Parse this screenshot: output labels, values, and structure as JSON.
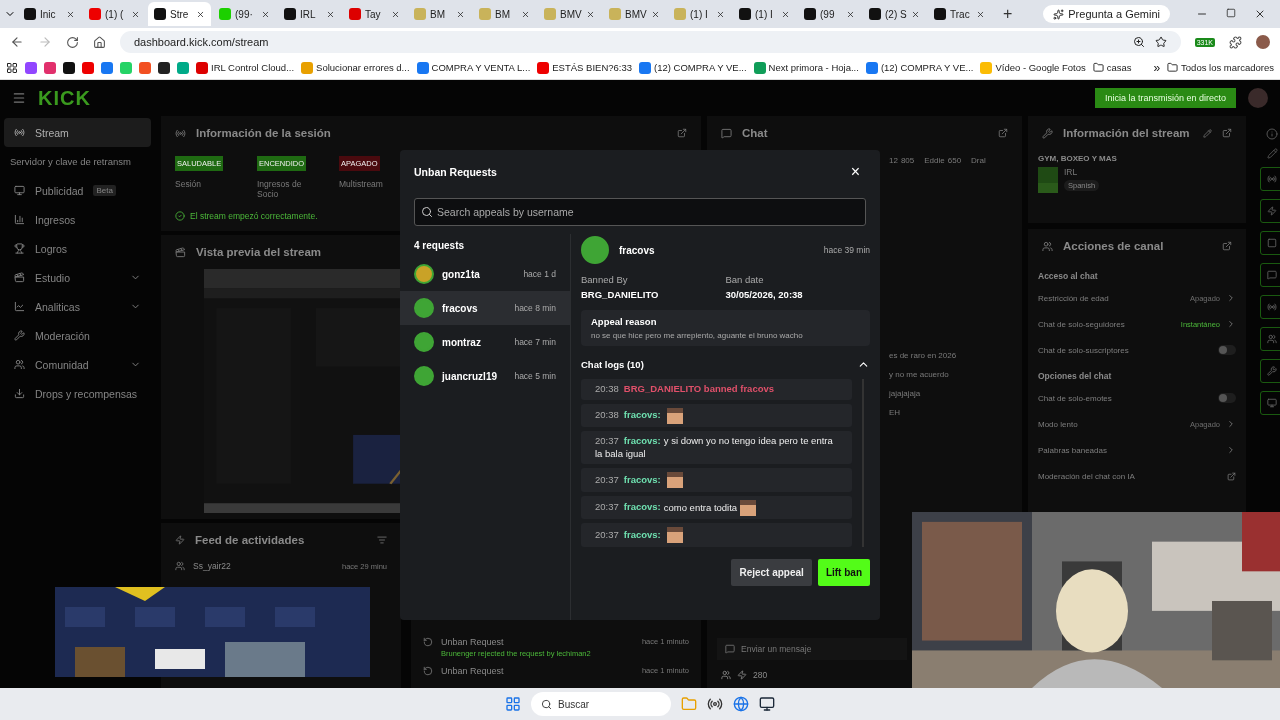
{
  "browser": {
    "tabs": [
      {
        "label": "Inic",
        "selected": false
      },
      {
        "label": "(1) (",
        "selected": false
      },
      {
        "label": "Stre",
        "selected": true
      },
      {
        "label": "(99·",
        "selected": false
      },
      {
        "label": "IRL",
        "selected": false
      },
      {
        "label": "Tay",
        "selected": false
      },
      {
        "label": "BM",
        "selected": false
      },
      {
        "label": "BM",
        "selected": false
      },
      {
        "label": "BMV",
        "selected": false
      },
      {
        "label": "BMV",
        "selected": false
      },
      {
        "label": "(1) I",
        "selected": false
      },
      {
        "label": "(1) I",
        "selected": false
      },
      {
        "label": "(99",
        "selected": false
      },
      {
        "label": "(2) S",
        "selected": false
      },
      {
        "label": "Trac",
        "selected": false
      }
    ],
    "new_tab": "+",
    "gemini": "Pregunta a Gemini",
    "url": "dashboard.kick.com/stream",
    "extension_badge": "331K",
    "bookmarks": [
      "IRL Control Cloud...",
      "Solucionar errores d...",
      "COMPRA Y VENTA L...",
      "ESTÁS BIEN?6:33",
      "(12) COMPRA Y VE...",
      "Next primora - Hoja...",
      "(12) COMPRA Y VE...",
      "Vídeo - Google Fotos",
      "casas"
    ],
    "bookmarks_more": "»",
    "all_bookmarks": "Todos los marcadores"
  },
  "header": {
    "logo": "KICK",
    "go_live": "Inicia la transmisión en directo"
  },
  "sidebar": {
    "items": [
      {
        "label": "Stream",
        "selected": true,
        "kind": "main"
      },
      {
        "label": "Servidor y clave de retransm",
        "selected": false,
        "kind": "sub"
      },
      {
        "label": "Publicidad",
        "badge": "Beta",
        "selected": false,
        "kind": "main"
      },
      {
        "label": "Ingresos",
        "selected": false,
        "kind": "main"
      },
      {
        "label": "Logros",
        "selected": false,
        "kind": "main"
      },
      {
        "label": "Estudio",
        "selected": false,
        "kind": "group"
      },
      {
        "label": "Analiticas",
        "selected": false,
        "kind": "group"
      },
      {
        "label": "Moderación",
        "selected": false,
        "kind": "main"
      },
      {
        "label": "Comunidad",
        "selected": false,
        "kind": "group"
      },
      {
        "label": "Drops y recompensas",
        "selected": false,
        "kind": "main"
      }
    ]
  },
  "session": {
    "title": "Información de la sesión",
    "statuses": [
      {
        "badge": "SALUDABLE",
        "label": "Sesión",
        "color": "#1f6a12"
      },
      {
        "badge": "ENCENDIDO",
        "label": "Ingresos de Socio",
        "color": "#1f6a12"
      },
      {
        "badge": "APAGADO",
        "label": "Multistream",
        "color": "#4a0a0e"
      }
    ],
    "message": "El stream empezó correctamente."
  },
  "preview": {
    "title": "Vista previa del stream"
  },
  "feed": {
    "title": "Feed de actividades",
    "items": [
      {
        "user": "Ss_yair22",
        "time": "hace 29 minu"
      }
    ]
  },
  "mod_log": {
    "items": [
      {
        "title": "Unban Request",
        "detail": "Brunenger rejected the request by lechiman2",
        "time": "hace 1 minuto"
      },
      {
        "title": "Unban Request",
        "time": "hace 1 minuto"
      }
    ]
  },
  "chat": {
    "title": "Chat",
    "leaders": [
      {
        "name": "12",
        "score": "805"
      },
      {
        "name": "Eddie",
        "score": "650"
      },
      {
        "name": "Dral"
      }
    ],
    "messages": [
      "es de raro en 2026",
      "y no me acuerdo",
      "jajajajaja",
      "EH"
    ],
    "input_placeholder": "Enviar un mensaje",
    "points": "280"
  },
  "stream_info": {
    "title": "Información del stream",
    "stream_title": "GYM, BOXEO Y MAS",
    "category": "IRL",
    "language": "Spanish"
  },
  "channel_actions": {
    "title": "Acciones de canal",
    "sections": [
      {
        "title": "Acceso al chat",
        "rows": [
          {
            "kind": "value",
            "label": "Restricción de edad",
            "value": "Apagado",
            "highlight": false
          },
          {
            "kind": "value",
            "label": "Chat de solo-seguidores",
            "value": "Instantáneo",
            "highlight": true
          },
          {
            "kind": "toggle",
            "label": "Chat de solo-suscriptores",
            "on": false
          }
        ]
      },
      {
        "title": "Opciones del chat",
        "rows": [
          {
            "kind": "toggle",
            "label": "Chat de solo-emotes",
            "on": false
          },
          {
            "kind": "value",
            "label": "Modo lento",
            "value": "Apagado",
            "highlight": false
          },
          {
            "kind": "link",
            "label": "Palabras baneadas"
          },
          {
            "kind": "external",
            "label": "Moderación del chat con IA"
          }
        ]
      }
    ]
  },
  "modal": {
    "title": "Unban Requests",
    "close": "×",
    "search_placeholder": "Search appeals by username",
    "count": "4 requests",
    "requests": [
      {
        "name": "gonz1ta",
        "time": "hace 1 d",
        "selected": false,
        "color": "#c9a227"
      },
      {
        "name": "fracovs",
        "time": "hace 8 min",
        "selected": true,
        "color": "#3fa535"
      },
      {
        "name": "montraz",
        "time": "hace 7 min",
        "selected": false,
        "color": "#3fa535"
      },
      {
        "name": "juancruzl19",
        "time": "hace 5 min",
        "selected": false,
        "color": "#3fa535"
      }
    ],
    "detail": {
      "name": "fracovs",
      "time": "hace 39 min",
      "banned_by_label": "Banned By",
      "banned_by": "BRG_DANIELITO",
      "ban_date_label": "Ban date",
      "ban_date": "30/05/2026, 20:38",
      "reason_label": "Appeal reason",
      "reason": "no se que hice pero me arrepiento, aguante el bruno wacho",
      "logs_title": "Chat logs (10)",
      "logs_expanded": true,
      "logs": [
        {
          "kind": "ban",
          "time": "20:38",
          "text": "BRG_DANIELITO banned fracovs"
        },
        {
          "kind": "message",
          "time": "20:38",
          "user": "fracovs:",
          "emote": true
        },
        {
          "kind": "message",
          "time": "20:37",
          "user": "fracovs:",
          "text": "y si down yo no tengo idea pero te entra la bala igual",
          "emote": false
        },
        {
          "kind": "message",
          "time": "20:37",
          "user": "fracovs:",
          "emote": true
        },
        {
          "kind": "message",
          "time": "20:37",
          "user": "fracovs:",
          "text": "como entra todita",
          "emote": true
        },
        {
          "kind": "message",
          "time": "20:37",
          "user": "fracovs:",
          "emote": true
        }
      ]
    },
    "reject": "Reject appeal",
    "lift": "Lift ban"
  },
  "taskbar": {
    "search_placeholder": "Buscar"
  }
}
